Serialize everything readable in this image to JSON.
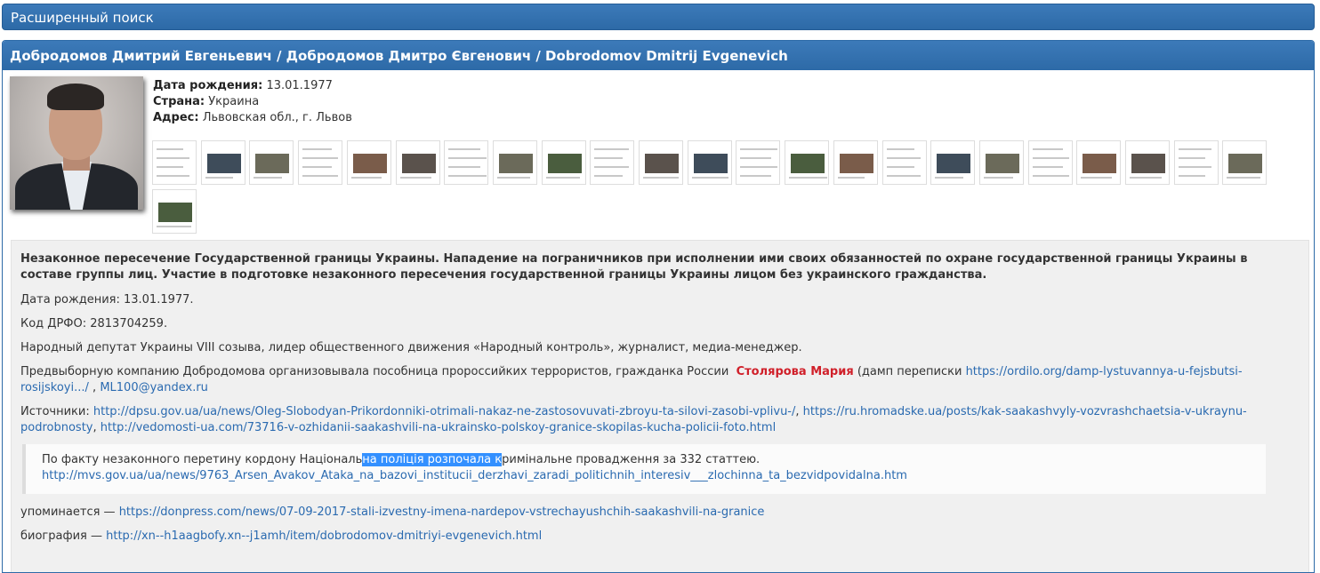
{
  "top_bar": {
    "title": "Расширенный поиск"
  },
  "profile": {
    "name": "Добродомов Дмитрий Евгеньевич / Добродомов Дмитро Євгенович / Dobrodomov Dmitrij Evgenevich",
    "birth_label": "Дата рождения:",
    "birth_value": "13.01.1977",
    "country_label": "Страна:",
    "country_value": "Украина",
    "address_label": "Адрес:",
    "address_value": "Львовская обл., г. Львов",
    "thumbnail_count": 24
  },
  "description": {
    "headline": "Незаконное пересечение Государственной границы Украины. Нападение на пограничников при исполнении ими своих обязанностей по охране государственной границы Украины в составе группы лиц. Участие в подготовке незаконного пересечения государственной границы Украины лицом без украинского гражданства.",
    "birth": "Дата рождения: 13.01.1977.",
    "drfo": "Код ДРФО: 2813704259.",
    "position": "Народный депутат Украины VIII созыва, лидер общественного движения «Народный контроль», журналист, медиа-менеджер.",
    "campaign_text": "Предвыборную компанию Добродомова организовывала пособница пророссийких террористов, гражданка России",
    "campaign_person": "Столярова Мария",
    "campaign_paren": "(дамп переписки",
    "campaign_link": "https://ordilo.org/damp-lystuvannya-u-fejsbutsi-rosijskoyi.../",
    "campaign_sep": ",",
    "campaign_email": "ML100@yandex.ru",
    "sources_label": "Источники:",
    "source_1": "http://dpsu.gov.ua/ua/news/Oleg-Slobodyan-Prikordonniki-otrimali-nakaz-ne-zastosovuvati-zbroyu-ta-silovi-zasobi-vplivu-/",
    "source_2": "https://ru.hromadske.ua/posts/kak-saakashvyly-vozvrashchaetsia-v-ukraynu-podrobnosty",
    "source_3": "http://vedomosti-ua.com/73716-v-ozhidanii-saakashvili-na-ukrainsko-polskoy-granice-skopilas-kucha-policii-foto.html",
    "quote_before": "По факту незаконного перетину кордону Національ",
    "quote_highlight": "на поліція розпочала к",
    "quote_after": "римінальне провадження за 332 статтею.",
    "quote_link": "http://mvs.gov.ua/ua/news/9763_Arsen_Avakov_Ataka_na_bazovi_institucii_derzhavi_zaradi_politichnih_interesiv___zlochinna_ta_bezvidpovidalna.htm",
    "mention_label": "упоминается —",
    "mention_link": "https://donpress.com/news/07-09-2017-stali-izvestny-imena-nardepov-vstrechayushchih-saakashvili-na-granice",
    "bio_label": "биография —",
    "bio_link": "http://xn--h1aagbofy.xn--j1amh/item/dobrodomov-dmitriyi-evgenevich.html"
  },
  "colors": {
    "header_blue": "#2d6aa7",
    "link": "#2a6ab0",
    "person_red": "#d0202a",
    "highlight": "#3390ff"
  }
}
